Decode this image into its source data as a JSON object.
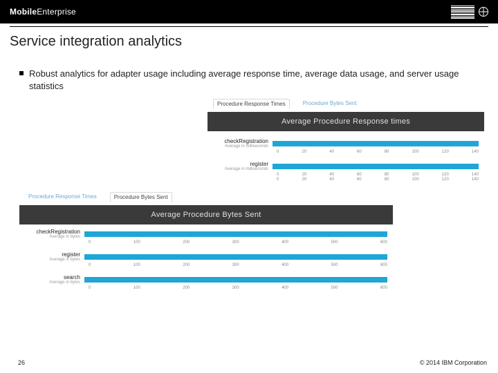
{
  "header": {
    "brand_bold": "Mobile",
    "brand_light": "Enterprise",
    "logo_name": "IBM"
  },
  "title": "Service integration analytics",
  "bullet": "Robust analytics for adapter usage including average response time, average data usage, and server usage statistics",
  "panels": {
    "response": {
      "tab_active": "Procedure Response Times",
      "tab_inactive": "Procedure Bytes Sent",
      "heading": "Average Procedure Response times",
      "rows": [
        {
          "label": "checkRegistration",
          "sub": "Average in milliseconds"
        },
        {
          "label": "register",
          "sub": "Average in milliseconds"
        }
      ],
      "axis1": [
        "0",
        "20",
        "40",
        "60",
        "80",
        "100",
        "120",
        "140"
      ],
      "axis2": [
        "0",
        "20",
        "40",
        "60",
        "80",
        "100",
        "120",
        "140"
      ],
      "axis3": [
        "0",
        "20",
        "40",
        "60",
        "80",
        "100",
        "120",
        "140"
      ]
    },
    "bytes": {
      "tab_active": "Procedure Bytes Sent",
      "tab_inactive": "Procedure Response Times",
      "heading": "Average Procedure Bytes Sent",
      "rows": [
        {
          "label": "checkRegistration",
          "sub": "Average in bytes"
        },
        {
          "label": "register",
          "sub": "Average in bytes"
        },
        {
          "label": "search",
          "sub": "Average in bytes"
        }
      ],
      "axis": [
        "0",
        "100",
        "200",
        "300",
        "400",
        "500",
        "600"
      ]
    }
  },
  "chart_data": [
    {
      "type": "bar",
      "title": "Average Procedure Response times",
      "xlabel": "",
      "ylabel": "milliseconds",
      "categories": [
        "checkRegistration",
        "register"
      ],
      "values": [
        140,
        140
      ],
      "ylim": [
        0,
        140
      ]
    },
    {
      "type": "bar",
      "title": "Average Procedure Bytes Sent",
      "xlabel": "",
      "ylabel": "bytes",
      "categories": [
        "checkRegistration",
        "register",
        "search"
      ],
      "values": [
        600,
        600,
        600
      ],
      "ylim": [
        0,
        600
      ]
    }
  ],
  "footer": {
    "page": "26",
    "copyright": "© 2014 IBM Corporation"
  }
}
